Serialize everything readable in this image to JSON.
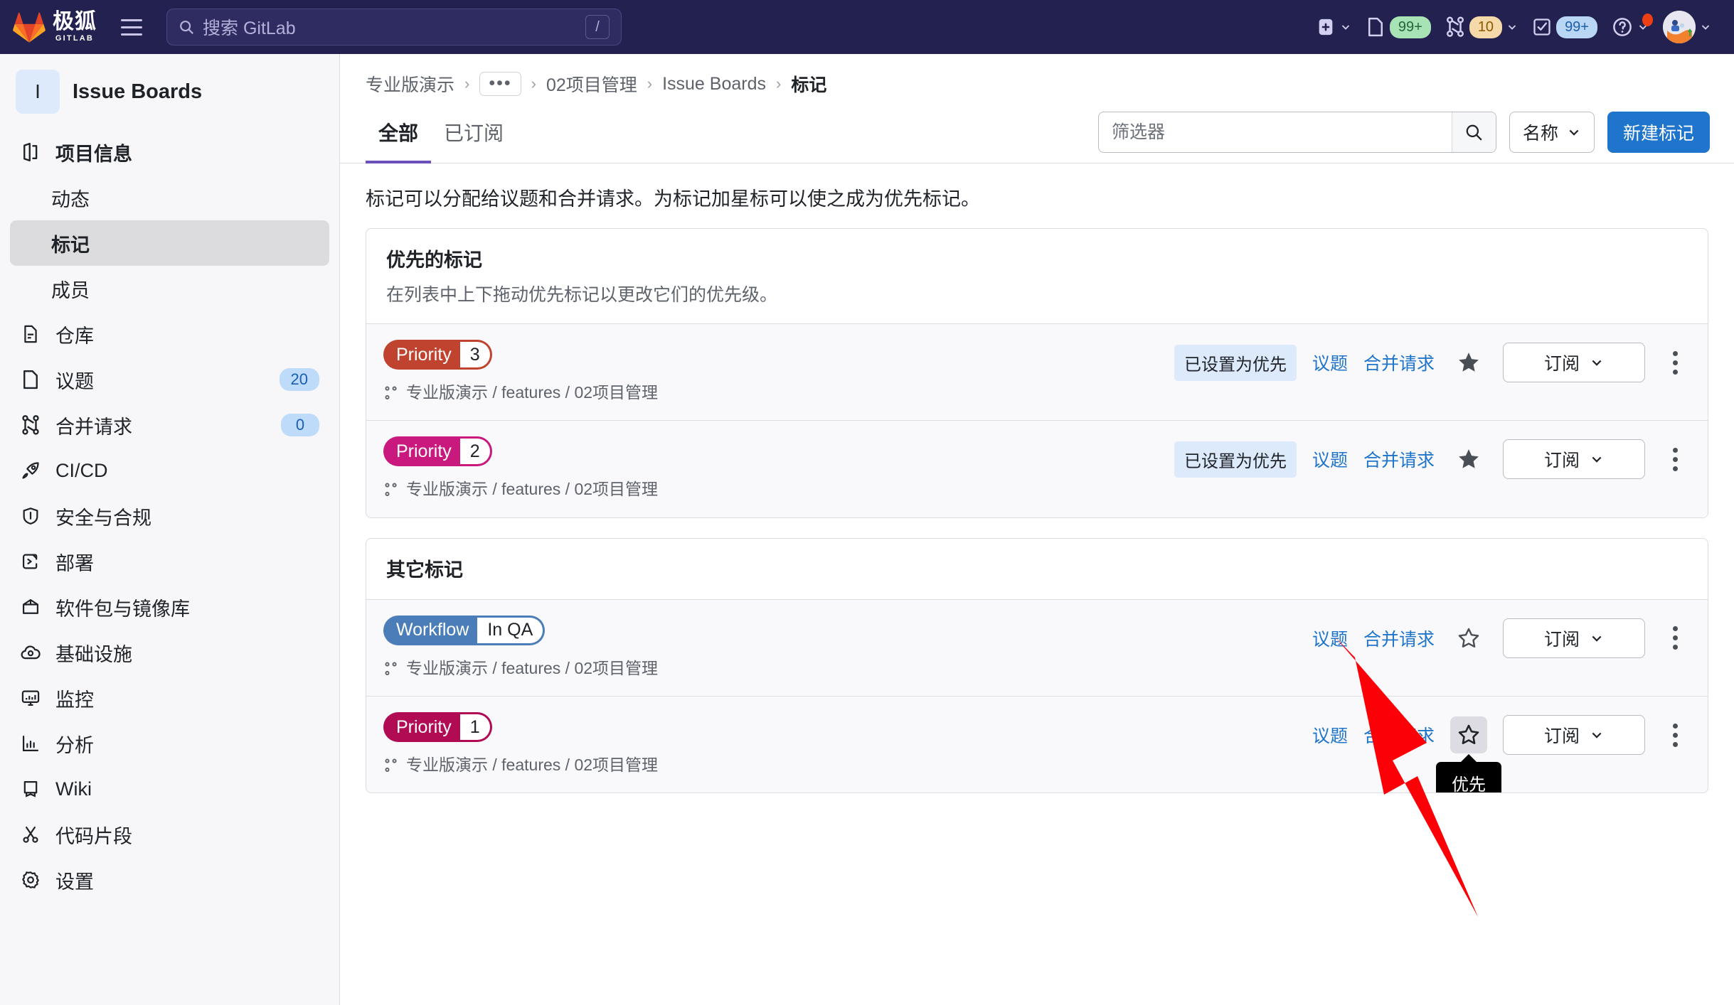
{
  "topbar": {
    "brand_cn": "极狐",
    "brand_sub": "GITLAB",
    "menu_icon": "hamburger-icon",
    "search": {
      "placeholder": "搜索 GitLab",
      "value": "",
      "shortcut": "/",
      "icon": "search-icon"
    },
    "actions": [
      {
        "name": "create-new-menu",
        "icon": "plus-square-icon",
        "badge": "",
        "chevron": true
      },
      {
        "name": "issues-menu",
        "icon": "issues-icon",
        "badge": "99+",
        "badge_color": "#a7e3b4",
        "chevron": false
      },
      {
        "name": "merge-requests-menu",
        "icon": "merge-request-icon",
        "badge": "10",
        "badge_color": "#f5d9a8",
        "chevron": true
      },
      {
        "name": "todos-menu",
        "icon": "todo-check-icon",
        "badge": "99+",
        "badge_color": "#b9d6f5",
        "chevron": false
      },
      {
        "name": "help-menu",
        "icon": "question-circle-icon",
        "badge": "",
        "chevron": true,
        "notification_dot": true
      },
      {
        "name": "user-menu",
        "icon": "avatar-icon",
        "badge": "",
        "chevron": true
      }
    ]
  },
  "sidebar": {
    "project": {
      "avatar_initial": "I",
      "name": "Issue Boards"
    },
    "items": [
      {
        "label": "项目信息",
        "icon": "project-info-icon",
        "sub": false,
        "active": false,
        "badge": ""
      },
      {
        "label": "动态",
        "icon": "",
        "sub": true,
        "active": false,
        "badge": ""
      },
      {
        "label": "标记",
        "icon": "",
        "sub": true,
        "active": true,
        "badge": ""
      },
      {
        "label": "成员",
        "icon": "",
        "sub": true,
        "active": false,
        "badge": ""
      },
      {
        "label": "仓库",
        "icon": "repository-icon",
        "sub": false,
        "active": false,
        "badge": ""
      },
      {
        "label": "议题",
        "icon": "issues-icon",
        "sub": false,
        "active": false,
        "badge": "20"
      },
      {
        "label": "合并请求",
        "icon": "merge-request-icon",
        "sub": false,
        "active": false,
        "badge": "0"
      },
      {
        "label": "CI/CD",
        "icon": "rocket-icon",
        "sub": false,
        "active": false,
        "badge": ""
      },
      {
        "label": "安全与合规",
        "icon": "shield-icon",
        "sub": false,
        "active": false,
        "badge": ""
      },
      {
        "label": "部署",
        "icon": "deploy-icon",
        "sub": false,
        "active": false,
        "badge": ""
      },
      {
        "label": "软件包与镜像库",
        "icon": "package-icon",
        "sub": false,
        "active": false,
        "badge": ""
      },
      {
        "label": "基础设施",
        "icon": "infrastructure-icon",
        "sub": false,
        "active": false,
        "badge": ""
      },
      {
        "label": "监控",
        "icon": "monitor-icon",
        "sub": false,
        "active": false,
        "badge": ""
      },
      {
        "label": "分析",
        "icon": "analytics-icon",
        "sub": false,
        "active": false,
        "badge": ""
      },
      {
        "label": "Wiki",
        "icon": "book-icon",
        "sub": false,
        "active": false,
        "badge": ""
      },
      {
        "label": "代码片段",
        "icon": "snippet-icon",
        "sub": false,
        "active": false,
        "badge": ""
      },
      {
        "label": "设置",
        "icon": "gear-icon",
        "sub": false,
        "active": false,
        "badge": ""
      }
    ]
  },
  "breadcrumb": {
    "items": [
      {
        "label": "专业版演示",
        "current": false,
        "ellipsis": false
      },
      {
        "label": "•••",
        "current": false,
        "ellipsis": true
      },
      {
        "label": "02项目管理",
        "current": false,
        "ellipsis": false
      },
      {
        "label": "Issue Boards",
        "current": false,
        "ellipsis": false
      },
      {
        "label": "标记",
        "current": true,
        "ellipsis": false
      }
    ],
    "separator": "›"
  },
  "tabs": [
    {
      "label": "全部",
      "active": true
    },
    {
      "label": "已订阅",
      "active": false
    }
  ],
  "toolbar": {
    "filter_placeholder": "筛选器",
    "filter_value": "",
    "search_icon": "search-icon",
    "sort_label": "名称",
    "sort_chevron": "chevron-down-icon",
    "new_label": "新建标记",
    "accent": "#1f75cb"
  },
  "page_description": "标记可以分配给议题和合并请求。为标记加星标可以使之成为优先标记。",
  "sections": [
    {
      "title": "优先的标记",
      "subtitle": "在列表中上下拖动优先标记以更改它们的优先级。",
      "rows": [
        {
          "label_key": "Priority",
          "label_value": "3",
          "color": "#c0432f",
          "scope_path": "专业版演示 / features / 02项目管理",
          "prio_chip": "已设置为优先",
          "issues_link": "议题",
          "mr_link": "合并请求",
          "star_filled": true,
          "star_hover": false,
          "subscribe_label": "订阅"
        },
        {
          "label_key": "Priority",
          "label_value": "2",
          "color": "#c9187e",
          "scope_path": "专业版演示 / features / 02项目管理",
          "prio_chip": "已设置为优先",
          "issues_link": "议题",
          "mr_link": "合并请求",
          "star_filled": true,
          "star_hover": false,
          "subscribe_label": "订阅"
        }
      ]
    },
    {
      "title": "其它标记",
      "subtitle": "",
      "rows": [
        {
          "label_key": "Workflow",
          "label_value": "In QA",
          "color": "#4b7eb8",
          "scope_path": "专业版演示 / features / 02项目管理",
          "prio_chip": "",
          "issues_link": "议题",
          "mr_link": "合并请求",
          "star_filled": false,
          "star_hover": false,
          "subscribe_label": "订阅"
        },
        {
          "label_key": "Priority",
          "label_value": "1",
          "color": "#b00b53",
          "scope_path": "专业版演示 / features / 02项目管理",
          "prio_chip": "",
          "issues_link": "议题",
          "mr_link": "合并请求",
          "star_filled": false,
          "star_hover": true,
          "subscribe_label": "订阅"
        }
      ]
    }
  ],
  "tooltip": {
    "text": "优先"
  },
  "annotation": {
    "arrow_color": "#fb0007"
  }
}
